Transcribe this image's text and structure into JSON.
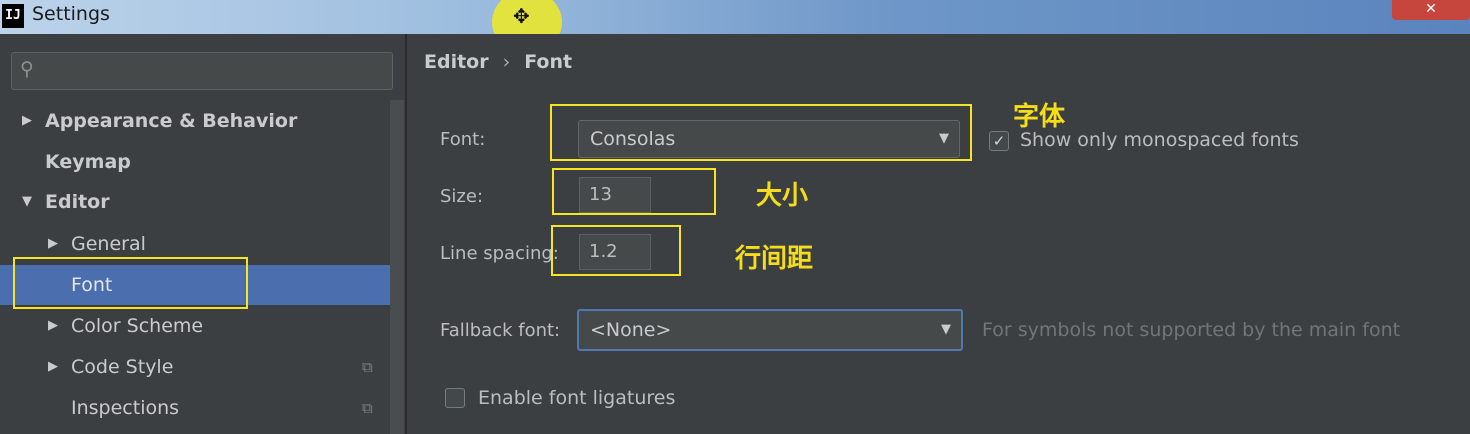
{
  "window": {
    "title": "Settings",
    "app_icon": "IJ",
    "close_label": "✕"
  },
  "search": {
    "placeholder": "",
    "icon": "search-icon"
  },
  "sidebar": {
    "items": [
      {
        "label": "Appearance & Behavior",
        "arrow": "▶"
      },
      {
        "label": "Keymap"
      },
      {
        "label": "Editor",
        "arrow": "▼"
      },
      {
        "label": "General",
        "arrow": "▶"
      },
      {
        "label": "Font"
      },
      {
        "label": "Color Scheme",
        "arrow": "▶"
      },
      {
        "label": "Code Style",
        "arrow": "▶"
      },
      {
        "label": "Inspections"
      }
    ],
    "selected": "Font"
  },
  "breadcrumb": {
    "parent": "Editor",
    "separator": "›",
    "current": "Font"
  },
  "form": {
    "font": {
      "label": "Font:",
      "value": "Consolas"
    },
    "monospaced": {
      "label": "Show only monospaced fonts",
      "checked": true,
      "check_glyph": "✓"
    },
    "size": {
      "label": "Size:",
      "value": "13"
    },
    "line_spacing": {
      "label": "Line spacing:",
      "value": "1.2"
    },
    "fallback": {
      "label": "Fallback font:",
      "value": "<None>",
      "hint": "For symbols not supported by the main font"
    },
    "ligatures": {
      "label": "Enable font ligatures",
      "checked": false
    }
  },
  "annotations": {
    "font": "字体",
    "size": "大小",
    "line_spacing": "行间距"
  },
  "colors": {
    "selection": "#4b6eaf",
    "annotation": "#f5e522",
    "background": "#3c3f41"
  }
}
